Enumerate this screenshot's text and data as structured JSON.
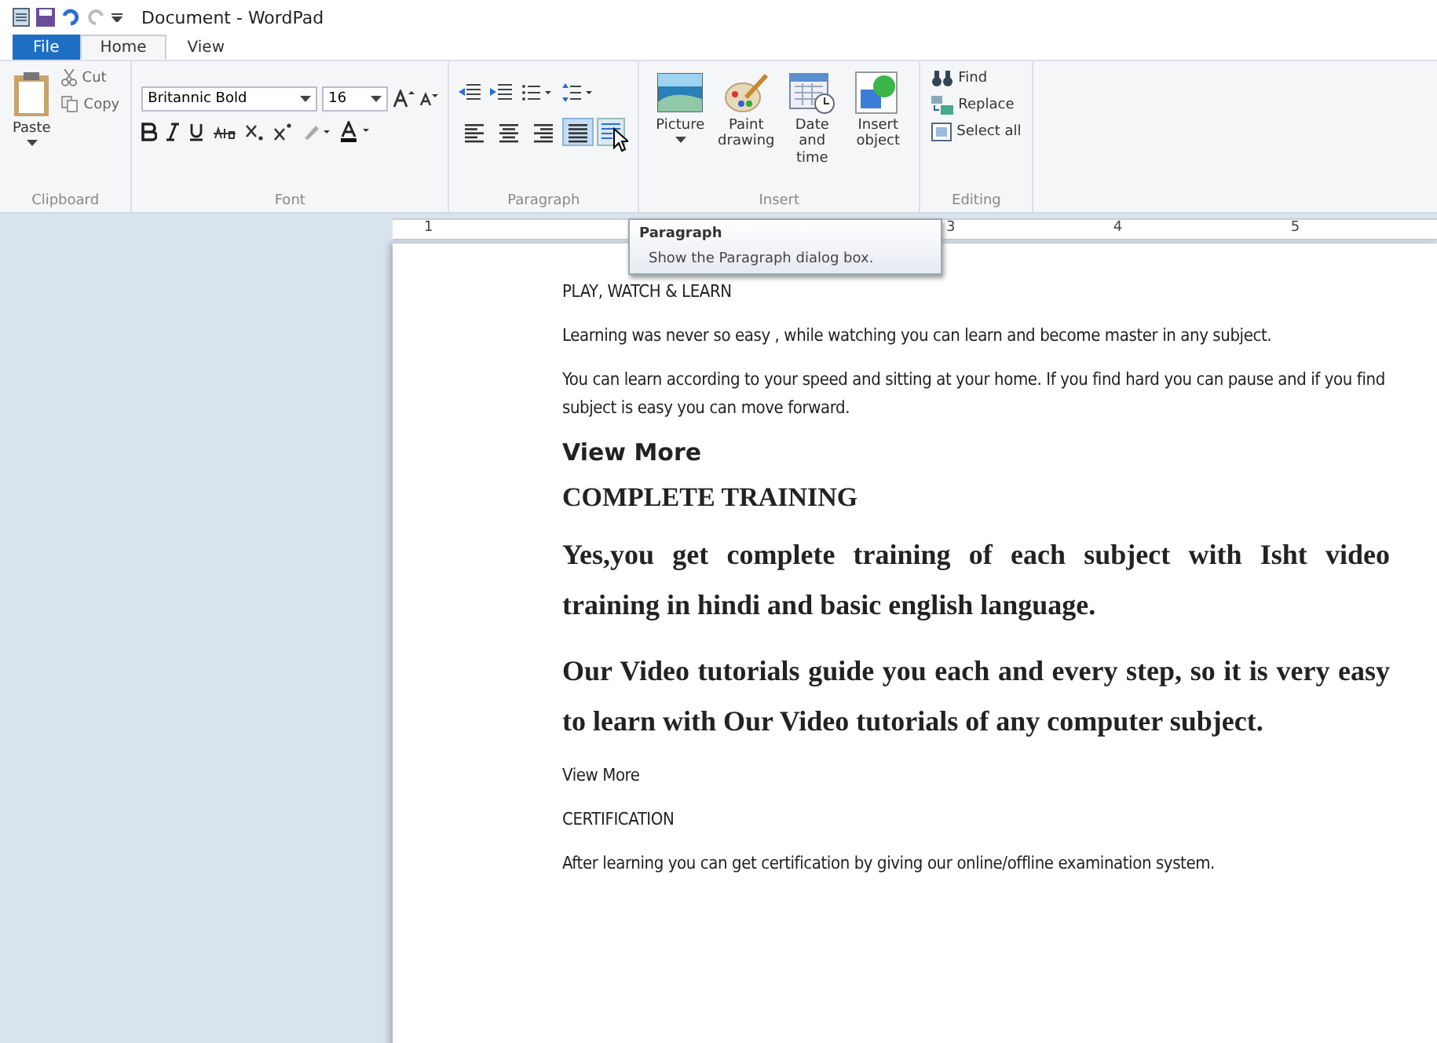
{
  "window": {
    "title": "Document - WordPad"
  },
  "tabs": [
    {
      "label": "File",
      "kind": "file",
      "selected": false
    },
    {
      "label": "Home",
      "kind": "tab",
      "selected": true
    },
    {
      "label": "View",
      "kind": "tab",
      "selected": false
    }
  ],
  "clipboard": {
    "paste": "Paste",
    "cut": "Cut",
    "copy": "Copy",
    "label": "Clipboard"
  },
  "font": {
    "name": "Britannic Bold",
    "size": "16",
    "label": "Font"
  },
  "paragraph": {
    "label": "Paragraph",
    "alignment": [
      {
        "kind": "left",
        "selected": false
      },
      {
        "kind": "center",
        "selected": false
      },
      {
        "kind": "right",
        "selected": false
      },
      {
        "kind": "justify",
        "selected": true
      }
    ]
  },
  "insert": {
    "label": "Insert",
    "items": [
      {
        "kind": "picture",
        "label": "Picture",
        "dropdown": true
      },
      {
        "kind": "paint",
        "label": "Paint drawing",
        "dropdown": false
      },
      {
        "kind": "datetime",
        "label": "Date and time",
        "dropdown": false
      },
      {
        "kind": "object",
        "label": "Insert object",
        "dropdown": false
      }
    ]
  },
  "editing": {
    "label": "Editing",
    "items": [
      {
        "kind": "find",
        "label": "Find"
      },
      {
        "kind": "replace",
        "label": "Replace"
      },
      {
        "kind": "selectall",
        "label": "Select all"
      }
    ]
  },
  "ruler": {
    "numbers": [
      "1",
      "3",
      "4",
      "5"
    ]
  },
  "tooltip": {
    "title": "Paragraph",
    "text": "Show the Paragraph dialog box."
  },
  "document": {
    "paragraphs": [
      {
        "kind": "plain",
        "text": "PLAY, WATCH & LEARN"
      },
      {
        "kind": "plain",
        "text": "Learning was never so easy , while watching you can learn and become master in any subject."
      },
      {
        "kind": "plain",
        "text": "You can learn according to your speed and sitting at your home. If you find hard you can pause and if you find subject is easy you can move forward."
      },
      {
        "kind": "sans-heading",
        "text": "View More"
      },
      {
        "kind": "serif-heading",
        "text": "COMPLETE TRAINING"
      },
      {
        "kind": "lead",
        "text": "Yes,you get complete training of each subject with Isht video training in hindi and basic english language."
      },
      {
        "kind": "lead",
        "text": "Our Video tutorials guide you each and every step, so it is very easy to learn with Our Video tutorials of any computer subject."
      },
      {
        "kind": "plain",
        "text": "View More"
      },
      {
        "kind": "plain",
        "text": "CERTIFICATION"
      },
      {
        "kind": "plain",
        "text": "After learning you can get certification by giving our online/offline examination system."
      }
    ]
  }
}
